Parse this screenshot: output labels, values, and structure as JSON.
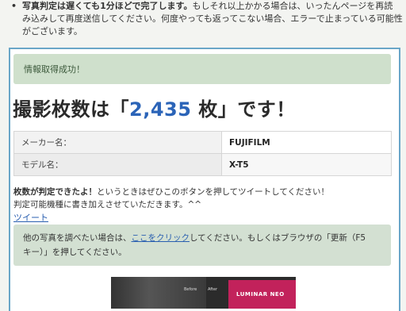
{
  "notice": {
    "bullet": "•",
    "line1_bold": "写真判定は遅くても1分ほどで完了します。",
    "line1_rest": "もしそれ以上かかる場合は、いったんページを再読",
    "line2": "み込みして再度送信してください。何度やっても返ってこない場合、エラーで止まっている可能性",
    "line3": "がございます。"
  },
  "success_message": "情報取得成功！",
  "headline": {
    "prefix": "撮影枚数は「",
    "count": "2,435",
    "unit": " 枚",
    "suffix": "」です！"
  },
  "info_table": {
    "rows": [
      {
        "label": "メーカー名：",
        "value": "FUJIFILM"
      },
      {
        "label": "モデル名：",
        "value": "X-T5"
      }
    ]
  },
  "tweet": {
    "line1_bold": "枚数が判定できたよ！",
    "line1_rest": "というときはぜひこのボタンを押してツイートしてください！",
    "line2": "判定可能機種に書き加えさせていただきます。^^",
    "link": "ツイート"
  },
  "info_alert": {
    "prefix": "他の写真を調べたい場合は、",
    "link": "ここをクリック",
    "rest": "してください。もしくはブラウザの「更新（F5",
    "line2": "キー）」を押してください。"
  },
  "banner": {
    "before": "Before",
    "after": "After",
    "brand": "LUMINAR NEO"
  },
  "colors": {
    "accent_blue": "#2b64b8",
    "success_bg": "#cfe0cc",
    "card_border": "#6aa6c8",
    "link": "#2a5fb0"
  }
}
